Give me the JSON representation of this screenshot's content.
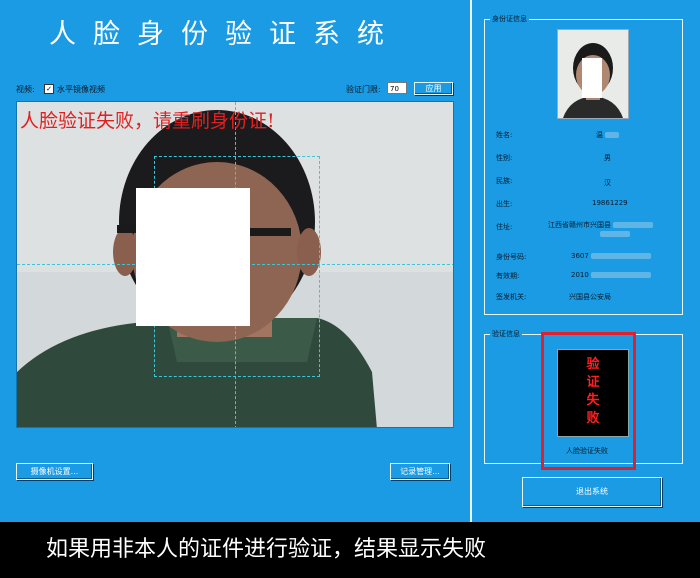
{
  "app": {
    "title": "人脸身份验证系统",
    "video_label": "视频:",
    "mirror_label": "水平镜像视频",
    "threshold_label": "验证门限:",
    "threshold_value": "70",
    "apply_button": "应用",
    "fail_message": "人脸验证失败，请重刷身份证!",
    "camera_button": "摄像机设置...",
    "records_button": "记录管理..."
  },
  "id_info": {
    "group_label": "身份证信息",
    "name_label": "姓名:",
    "name_value": "温",
    "gender_label": "性别:",
    "gender_value": "男",
    "ethnicity_label": "民族:",
    "ethnicity_value": "汉",
    "birth_label": "出生:",
    "birth_value": "19861229",
    "address_label": "住址:",
    "address_value": "江西省赣州市兴国县",
    "id_number_label": "身份号码:",
    "id_number_value": "3607",
    "valid_label": "有效期:",
    "valid_value": "2010",
    "issuer_label": "签发机关:",
    "issuer_value": "兴国县公安局"
  },
  "verify": {
    "group_label": "验证信息",
    "result_text": "验证失败",
    "status_text": "人脸验证失败",
    "exit_button": "退出系统"
  },
  "caption": "如果用非本人的证件进行验证，结果显示失败"
}
